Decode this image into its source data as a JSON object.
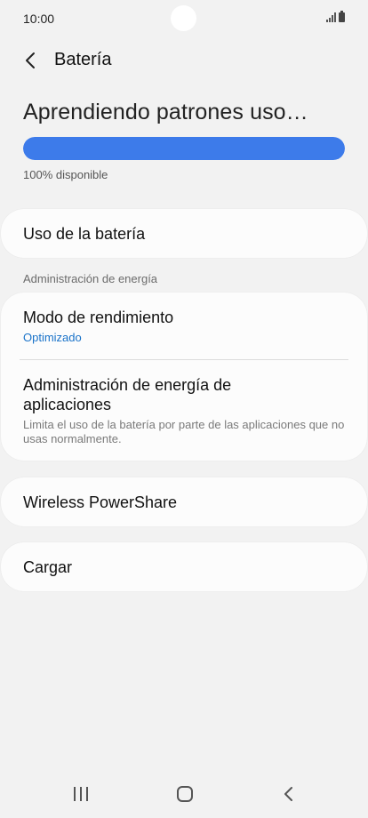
{
  "status_bar": {
    "time": "10:00"
  },
  "header": {
    "title": "Batería"
  },
  "battery": {
    "learning_text": "Aprendiendo patrones uso…",
    "progress_fraction": 1.0,
    "available_text": "100% disponible"
  },
  "items": {
    "usage": {
      "title": "Uso de la batería"
    },
    "power_section_label": "Administración de energía",
    "performance_mode": {
      "title": "Modo de rendimiento",
      "value": "Optimizado"
    },
    "app_power": {
      "title": "Administración de energía de aplicaciones",
      "description": "Limita el uso de la batería por parte de las aplicaciones que no usas normalmente."
    },
    "wireless_powershare": {
      "title": "Wireless PowerShare"
    },
    "charge": {
      "title": "Cargar"
    }
  },
  "colors": {
    "accent": "#3d7bea",
    "link_blue": "#1a73c9",
    "background": "#f2f2f2",
    "card": "#fcfcfc"
  },
  "icons": [
    "back-icon",
    "signal-icon",
    "battery-icon",
    "nav-recents-icon",
    "nav-home-icon",
    "nav-back-icon"
  ]
}
